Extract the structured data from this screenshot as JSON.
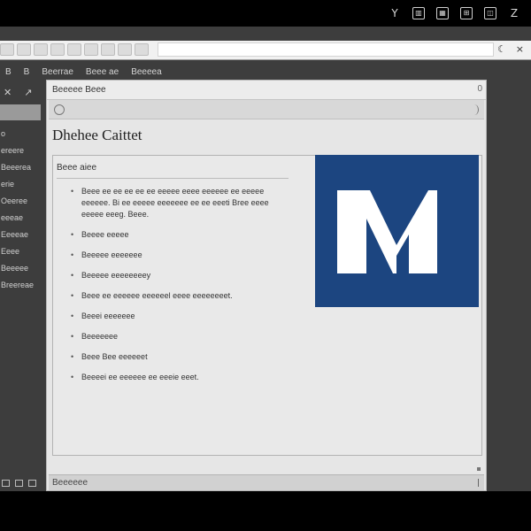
{
  "tray_icons": [
    "Y",
    "▥",
    "▦",
    "⊞",
    "◫",
    "Z"
  ],
  "tabbar": {
    "chip_count": 9,
    "moon_glyph": "☾",
    "close_glyph": "×"
  },
  "toolrow": {
    "items": [
      "B",
      "B",
      "Beerrae",
      "Beee ae",
      "Beeeea"
    ]
  },
  "sidebar": {
    "tools": [
      "✕",
      "↗"
    ],
    "items": [
      "o",
      "ereere",
      "Beeerea",
      "erie",
      "Oeeree",
      "eeeae",
      "Eeeeae",
      "Eeee",
      "Beeeee",
      "Breereae"
    ]
  },
  "window": {
    "title": "Beeeee Beee",
    "scroll_glyph": "0",
    "doc_title": "Dhehee Caittet",
    "panel_heading": "Beee aiee",
    "bullets": [
      "Beee ee ee ee ee ee eeeee eeee eeeeee ee eeeee eeeeee. Bi ee eeeee eeeeeee ee ee eeeti Bree eeee eeeee eeeg. Beee.",
      "Beeee eeeee",
      "Beeeee eeeeeee",
      "Beeeee eeeeeeeey",
      "Beee ee eeeeee eeeeeel eeee eeeeeeeet.",
      "Beeei eeeeeee",
      "Beeeeeee",
      "Beee Bee eeeeeet",
      "Beeeei ee eeeeee ee eeeie eeet."
    ],
    "status_text": "Beeeeee"
  },
  "logo": {
    "letter": "M",
    "bg_color": "#1c4580",
    "fg_color": "#ffffff"
  }
}
